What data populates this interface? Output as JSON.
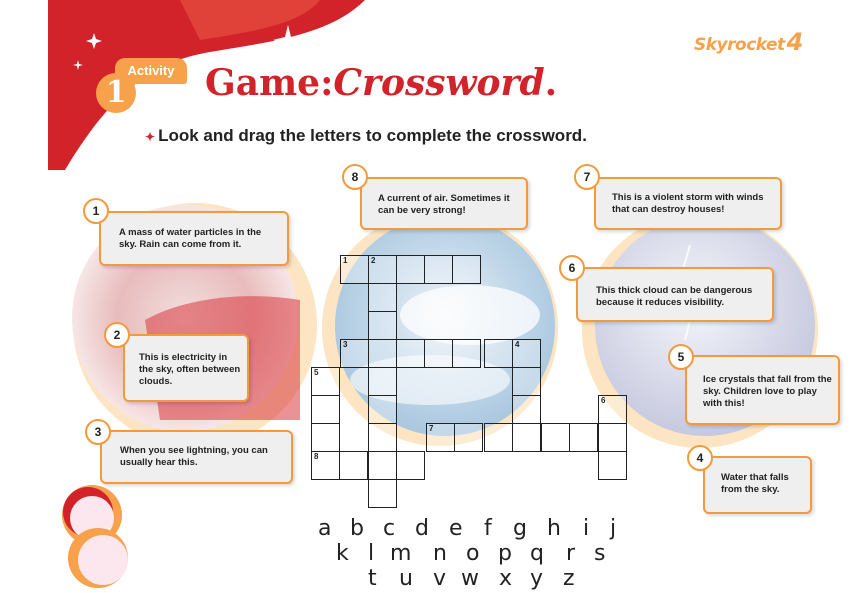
{
  "brand": {
    "name": "Skyrocket",
    "level": "4"
  },
  "activity": {
    "label": "Activity",
    "number": "1"
  },
  "title": {
    "part1": "Game:",
    "part2": "Crossword",
    "dot": "."
  },
  "instruction": "Look and drag the letters to complete the crossword.",
  "clues": [
    {
      "number": "1",
      "text": "A mass of water particles in the sky. Rain can come from it."
    },
    {
      "number": "2",
      "text": "This is electricity in the sky, often between clouds."
    },
    {
      "number": "3",
      "text": "When you see lightning, you can usually hear this."
    },
    {
      "number": "4",
      "text": "Water that falls from the sky."
    },
    {
      "number": "5",
      "text": "Ice crystals that fall from the sky. Children love to play with this!"
    },
    {
      "number": "6",
      "text": "This thick cloud can be dangerous because it reduces visibility."
    },
    {
      "number": "7",
      "text": "This is a violent storm with winds that can destroy houses!"
    },
    {
      "number": "8",
      "text": "A current of air. Sometimes it can be very strong!"
    }
  ],
  "grid_numbers": {
    "n1": "1",
    "n2": "2",
    "n3": "3",
    "n4": "4",
    "n5": "5",
    "n6": "6",
    "n7": "7",
    "n8": "8"
  },
  "letters": [
    "a",
    "b",
    "c",
    "d",
    "e",
    "f",
    "g",
    "h",
    "i",
    "j",
    "k",
    "l",
    "m",
    "n",
    "o",
    "p",
    "q",
    "r",
    "s",
    "t",
    "u",
    "v",
    "w",
    "x",
    "y",
    "z"
  ],
  "colors": {
    "accent_red": "#d3232a",
    "accent_orange": "#f49a3c"
  }
}
